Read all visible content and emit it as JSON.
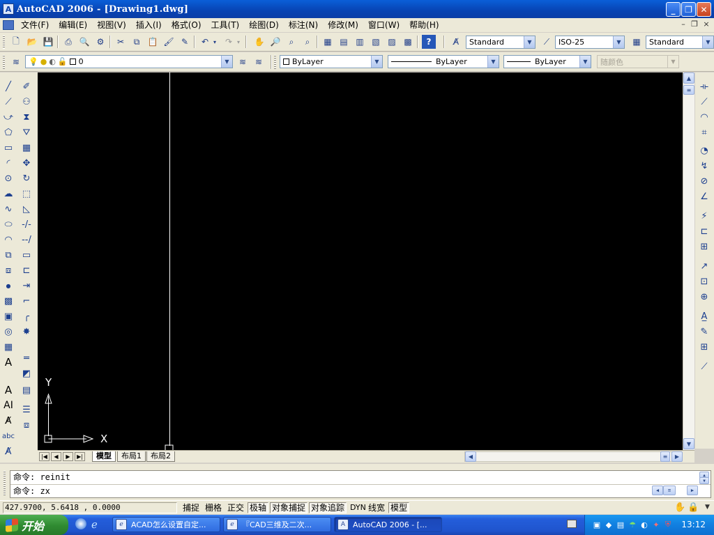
{
  "window": {
    "title": "AutoCAD 2006 - [Drawing1.dwg]",
    "controls": [
      "minimize",
      "restore",
      "close"
    ]
  },
  "menu": {
    "items": [
      "文件(F)",
      "编辑(E)",
      "视图(V)",
      "插入(I)",
      "格式(O)",
      "工具(T)",
      "绘图(D)",
      "标注(N)",
      "修改(M)",
      "窗口(W)",
      "帮助(H)"
    ]
  },
  "toolbar_standard": {
    "text_style": "Standard",
    "dim_style": "ISO-25",
    "table_style": "Standard"
  },
  "toolbar_layers": {
    "layer": "0",
    "color": "ByLayer",
    "linetype": "ByLayer",
    "lineweight": "ByLayer",
    "plotstyle": "随颜色"
  },
  "canvas": {
    "background": "#000000",
    "ucs_x_label": "X",
    "ucs_y_label": "Y"
  },
  "layout_tabs": [
    "模型",
    "布局1",
    "布局2"
  ],
  "command": {
    "history": "命令: reinit",
    "current": "命令: zx"
  },
  "status": {
    "coords": "427.9700,  5.6418   , 0.0000",
    "toggles": [
      {
        "label": "捕捉",
        "on": false
      },
      {
        "label": "栅格",
        "on": false
      },
      {
        "label": "正交",
        "on": false
      },
      {
        "label": "极轴",
        "on": true
      },
      {
        "label": "对象捕捉",
        "on": true
      },
      {
        "label": "对象追踪",
        "on": true
      },
      {
        "label": "DYN",
        "on": false
      },
      {
        "label": "线宽",
        "on": false
      },
      {
        "label": "模型",
        "on": true
      }
    ]
  },
  "taskbar": {
    "start_label": "开始",
    "tasks": [
      {
        "label": "ACAD怎么设置自定...",
        "active": false
      },
      {
        "label": "『CAD三维及二次...",
        "active": false
      },
      {
        "label": "AutoCAD 2006 - [...",
        "active": true
      }
    ],
    "clock": "13:12"
  }
}
